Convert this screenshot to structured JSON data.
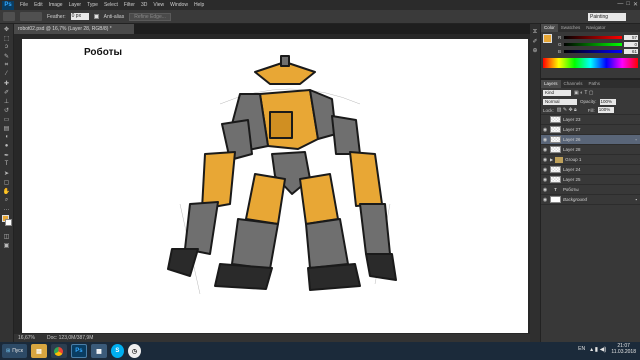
{
  "app": {
    "logo": "Ps"
  },
  "menu": [
    "File",
    "Edit",
    "Image",
    "Layer",
    "Type",
    "Select",
    "Filter",
    "3D",
    "View",
    "Window",
    "Help"
  ],
  "window_controls": [
    "—",
    "□",
    "✕"
  ],
  "options": {
    "feather_label": "Feather:",
    "feather_value": "0 px",
    "anti_alias_label": "Anti-alias",
    "refine_label": "Refine Edge...",
    "workspace": "Painting"
  },
  "document": {
    "tab_title": "robot02.psd @ 16,7% (Layer 28, RGB/8) *",
    "canvas_title": "Роботы"
  },
  "status": {
    "zoom": "16,67%",
    "doc_size": "Doc: 123,0M/387,9M"
  },
  "color_panel": {
    "tabs": [
      "Color",
      "Swatches",
      "Navigator"
    ],
    "channels": [
      {
        "label": "R",
        "value": "57"
      },
      {
        "label": "G",
        "value": "0"
      },
      {
        "label": "B",
        "value": "61"
      }
    ],
    "foreground": "#e8a735",
    "background": "#ffffff"
  },
  "layers_panel": {
    "tabs": [
      "Layers",
      "Channels",
      "Paths"
    ],
    "kind_label": "Kind",
    "blend_mode": "Normal",
    "opacity_label": "Opacity:",
    "opacity_value": "100%",
    "lock_label": "Lock:",
    "fill_label": "Fill:",
    "fill_value": "100%",
    "layers": [
      {
        "name": "Layer 23",
        "type": "checker",
        "visible": false,
        "selected": false
      },
      {
        "name": "Layer 27",
        "type": "checker",
        "visible": true,
        "selected": false
      },
      {
        "name": "Layer 26",
        "type": "checker",
        "visible": true,
        "selected": true
      },
      {
        "name": "Layer 28",
        "type": "checker",
        "visible": true,
        "selected": false
      },
      {
        "name": "Group 1",
        "type": "group",
        "visible": true,
        "selected": false
      },
      {
        "name": "Layer 24",
        "type": "checker",
        "visible": true,
        "selected": false
      },
      {
        "name": "Layer 25",
        "type": "checker",
        "visible": true,
        "selected": false
      },
      {
        "name": "Роботы",
        "type": "text",
        "visible": true,
        "selected": false
      },
      {
        "name": "Background",
        "type": "white",
        "visible": true,
        "selected": false
      }
    ]
  },
  "taskbar": {
    "start_label": "Пуск",
    "apps": [
      "Explorer",
      "Chrome",
      "Photoshop",
      "Media",
      "Skype",
      "Clock"
    ],
    "lang": "EN",
    "time": "21:07",
    "date": "11.03.2018"
  },
  "colors": {
    "robot_orange": "#e8a735",
    "robot_gray": "#6f6f6f",
    "robot_dark": "#2a2a2a"
  }
}
